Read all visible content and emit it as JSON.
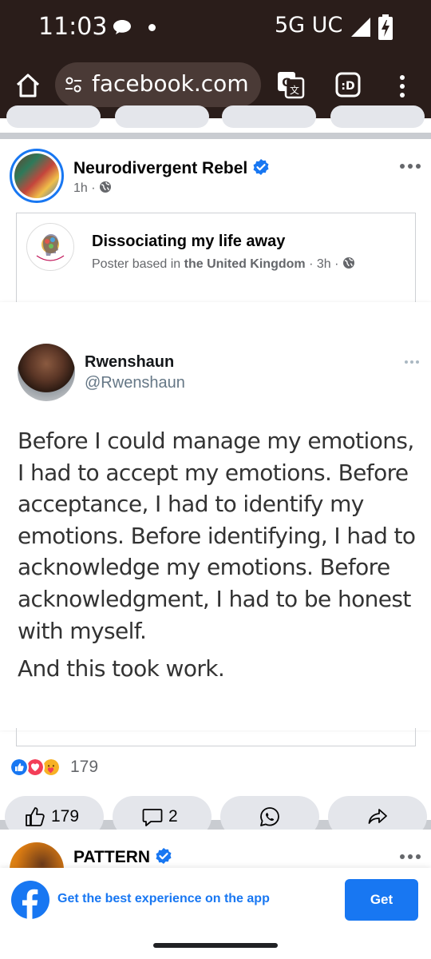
{
  "status_bar": {
    "time": "11:03",
    "network": "5G UC"
  },
  "browser": {
    "url": "facebook.com"
  },
  "post": {
    "author": "Neurodivergent Rebel",
    "time": "1h",
    "separator": "·",
    "shared": {
      "group_name": "Dissociating my life away",
      "meta_prefix": "Poster based in",
      "meta_location": "the United Kingdom",
      "meta_time": "3h"
    },
    "tweet": {
      "name": "Rwenshaun",
      "handle": "@Rwenshaun",
      "body": "Before I could manage my emotions, I had to accept my emotions. Before acceptance, I had to identify my emotions. Before identifying, I had to acknowledge my emotions. Before acknowledgment, I had to be honest with myself.",
      "body2": "And this took work."
    },
    "reaction_count": "179",
    "actions": {
      "like_count": "179",
      "comment_count": "2"
    }
  },
  "next_post": {
    "author": "PATTERN"
  },
  "app_banner": {
    "text": "Get the best experience on the app",
    "button": "Get"
  },
  "colors": {
    "facebook_blue": "#1877f2",
    "status_bar_bg": "#2a1d1a",
    "meta_gray": "#65676b"
  }
}
